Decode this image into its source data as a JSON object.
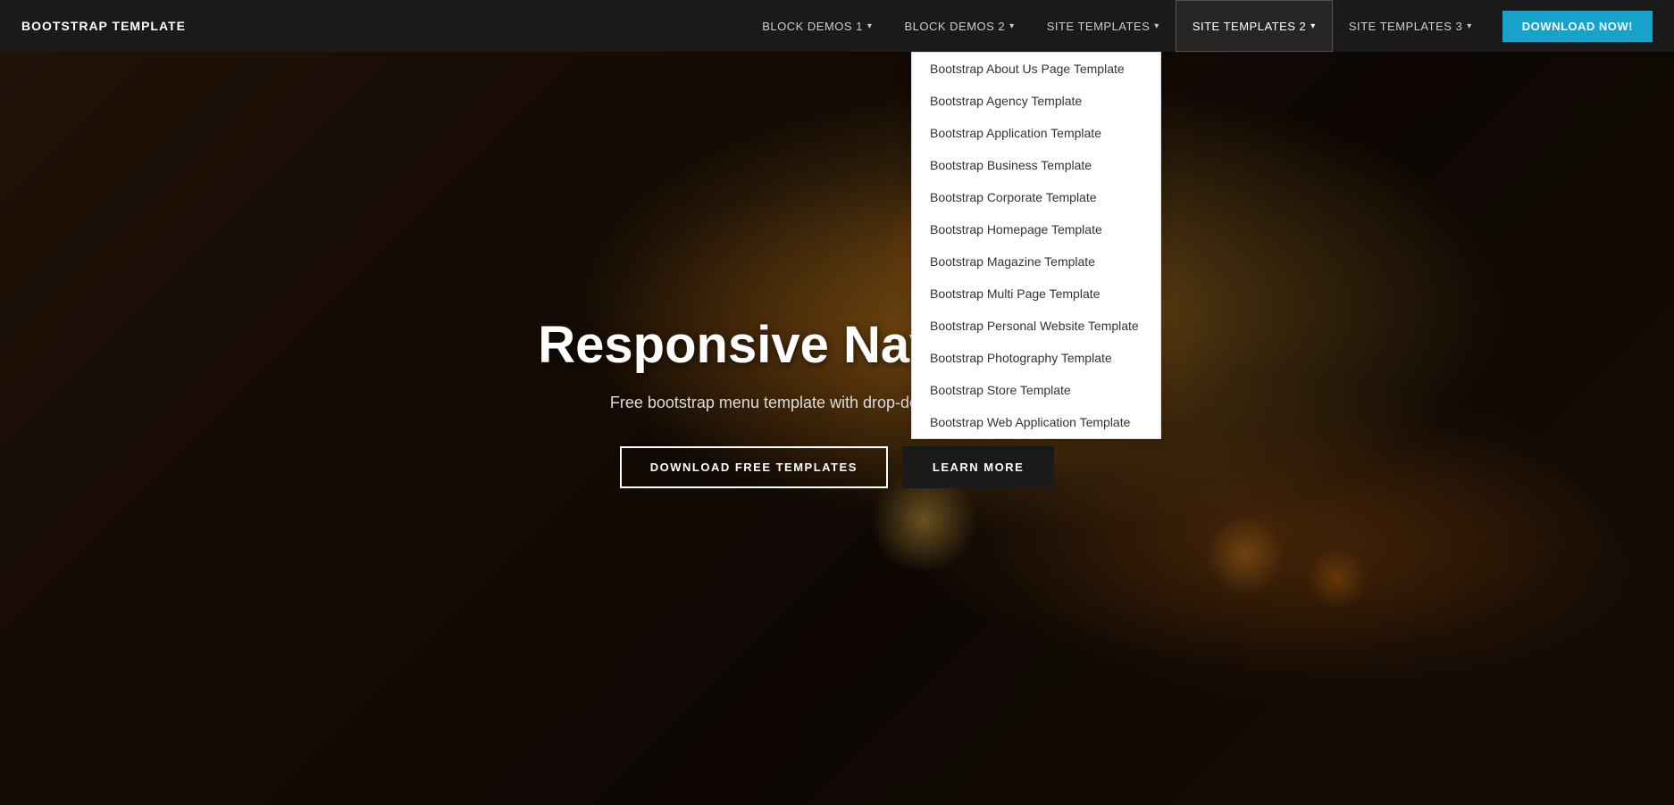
{
  "navbar": {
    "brand": "BOOTSTRAP TEMPLATE",
    "items": [
      {
        "id": "block-demos-1",
        "label": "BLOCK DEMOS 1",
        "hasDropdown": true
      },
      {
        "id": "block-demos-2",
        "label": "BLOCK DEMOS 2",
        "hasDropdown": true
      },
      {
        "id": "site-templates",
        "label": "SITE TEMPLATES",
        "hasDropdown": true
      },
      {
        "id": "site-templates-2",
        "label": "SITE TEMPLATES 2",
        "hasDropdown": true,
        "active": true
      },
      {
        "id": "site-templates-3",
        "label": "SITE TEMPLATES 3",
        "hasDropdown": true
      }
    ],
    "cta": "DOWNLOAD NOW!"
  },
  "dropdown": {
    "items": [
      "Bootstrap About Us Page Template",
      "Bootstrap Agency Template",
      "Bootstrap Application Template",
      "Bootstrap Business Template",
      "Bootstrap Corporate Template",
      "Bootstrap Homepage Template",
      "Bootstrap Magazine Template",
      "Bootstrap Multi Page Template",
      "Bootstrap Personal Website Template",
      "Bootstrap Photography Template",
      "Bootstrap Store Template",
      "Bootstrap Web Application Template"
    ]
  },
  "hero": {
    "title": "Responsive Navbar Tem",
    "subtitle": "Free bootstrap menu template with drop-down lists and buttons.",
    "btn_download": "DOWNLOAD FREE TEMPLATES",
    "btn_learn": "LEARN MORE"
  }
}
